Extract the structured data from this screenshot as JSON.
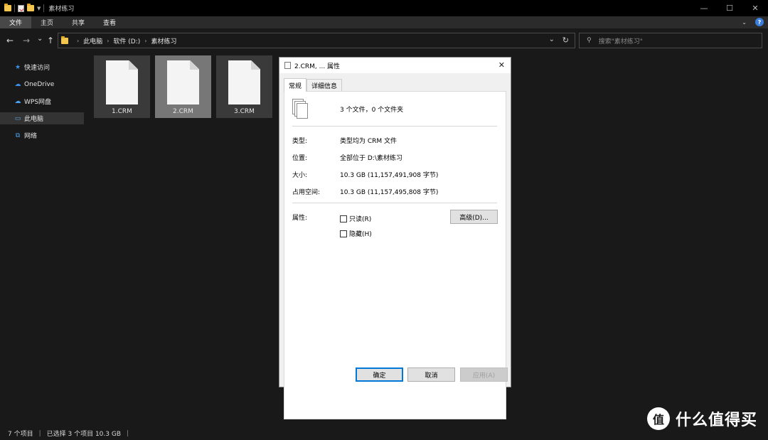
{
  "titlebar": {
    "title": "素材练习",
    "minimize": "—",
    "maximize": "☐",
    "close": "✕"
  },
  "ribbon": {
    "tabs": [
      {
        "label": "文件",
        "active": true
      },
      {
        "label": "主页",
        "active": false
      },
      {
        "label": "共享",
        "active": false
      },
      {
        "label": "查看",
        "active": false
      }
    ]
  },
  "nav": {
    "back": "←",
    "forward": "→",
    "recent": "⌄",
    "up": "↑"
  },
  "address": {
    "crumbs": [
      "此电脑",
      "软件 (D:)",
      "素材练习"
    ],
    "dropdown": "⌄",
    "refresh": "↻"
  },
  "search": {
    "placeholder": "搜索\"素材练习\""
  },
  "sidebar": {
    "items": [
      {
        "label": "快速访问",
        "icon": "star-icon",
        "selected": false
      },
      {
        "label": "OneDrive",
        "icon": "cloud-icon",
        "selected": false
      },
      {
        "label": "WPS网盘",
        "icon": "cloud-icon",
        "selected": false
      },
      {
        "label": "此电脑",
        "icon": "computer-icon",
        "selected": true
      },
      {
        "label": "网络",
        "icon": "network-icon",
        "selected": false
      }
    ]
  },
  "files": [
    {
      "name": "1.CRM",
      "state": "highlight"
    },
    {
      "name": "2.CRM",
      "state": "selected"
    },
    {
      "name": "3.CRM",
      "state": "highlight"
    }
  ],
  "statusbar": {
    "items_count": "7 个项目",
    "selected": "已选择 3 个项目  10.3 GB"
  },
  "watermark": {
    "logo": "值",
    "text": "什么值得买"
  },
  "dialog": {
    "title": "2.CRM, ... 属性",
    "close": "✕",
    "tabs": [
      {
        "label": "常规",
        "active": true
      },
      {
        "label": "详细信息",
        "active": false
      }
    ],
    "summary": "3 个文件，0 个文件夹",
    "props": [
      {
        "label": "类型:",
        "value": "类型均为 CRM 文件"
      },
      {
        "label": "位置:",
        "value": "全部位于 D:\\素材练习"
      },
      {
        "label": "大小:",
        "value": "10.3 GB (11,157,491,908 字节)"
      },
      {
        "label": "占用空间:",
        "value": "10.3 GB (11,157,495,808 字节)"
      }
    ],
    "attributes_label": "属性:",
    "readonly_label": "只读(R)",
    "hidden_label": "隐藏(H)",
    "advanced_button": "高级(D)...",
    "ok_button": "确定",
    "cancel_button": "取消",
    "apply_button": "应用(A)"
  }
}
